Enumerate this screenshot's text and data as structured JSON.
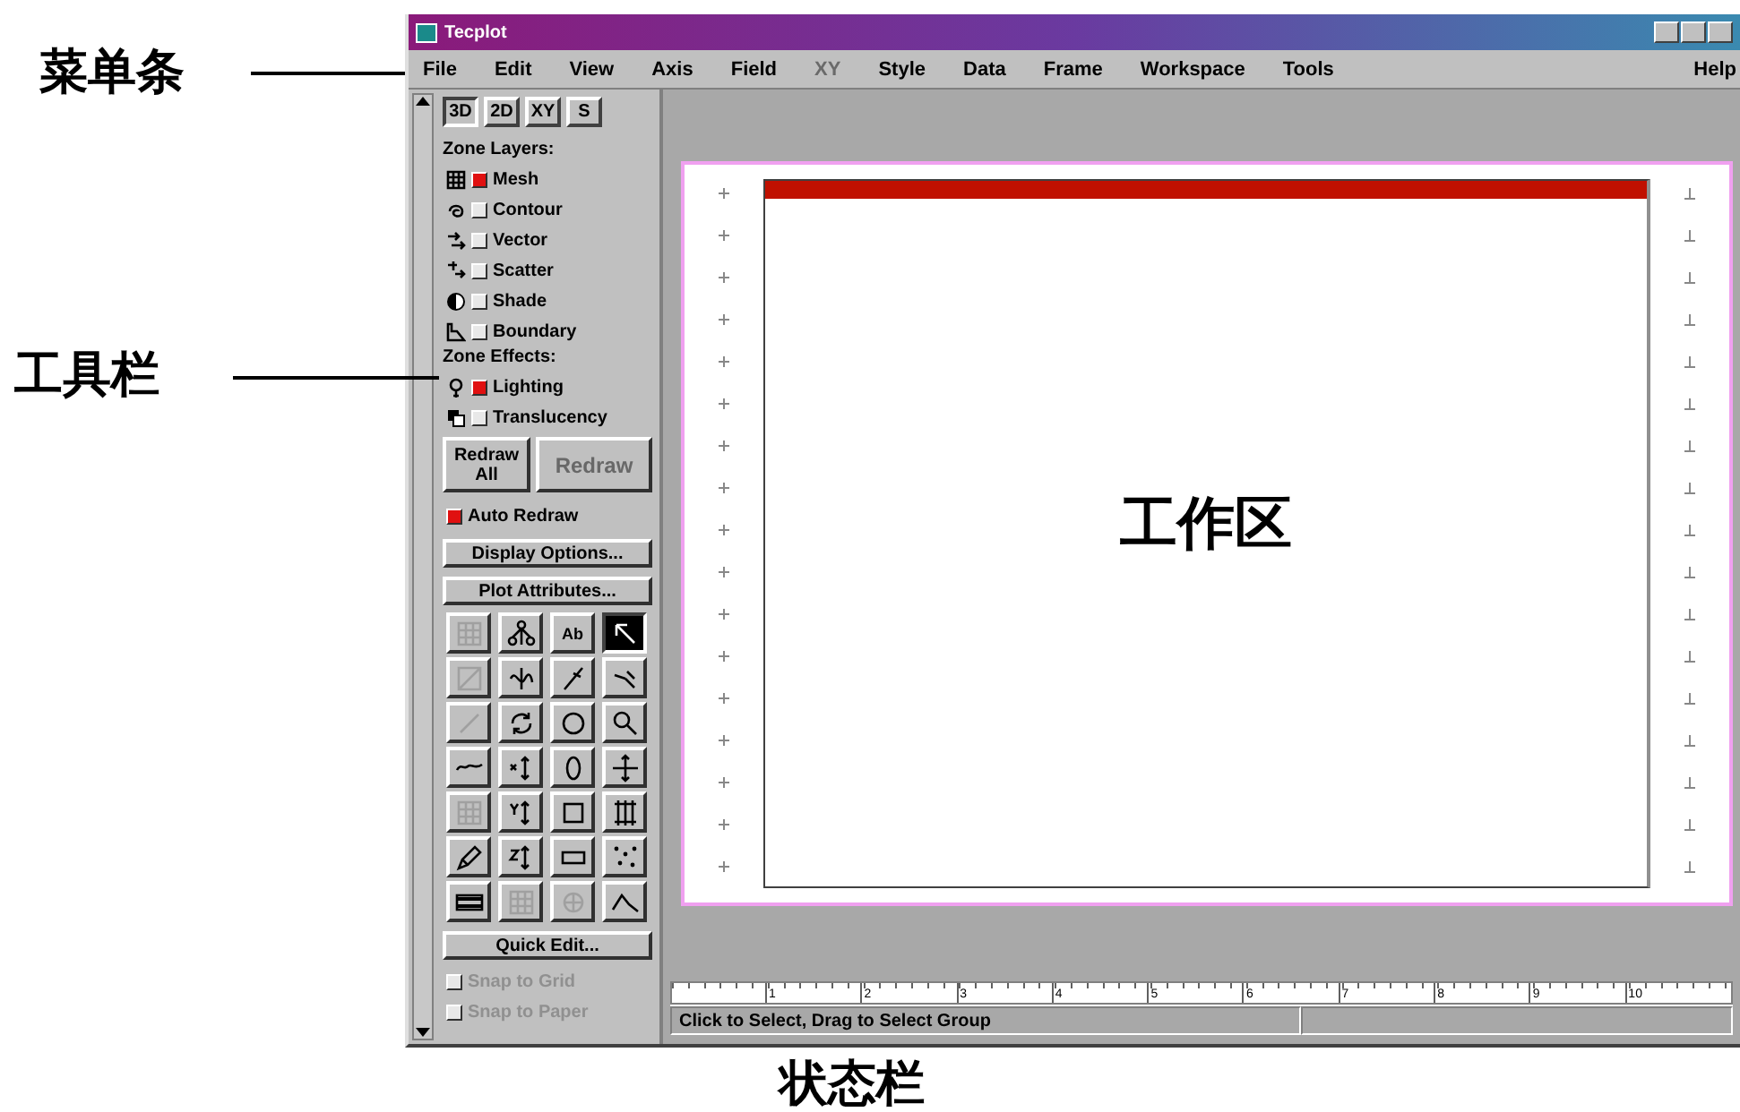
{
  "window": {
    "title": "Tecplot"
  },
  "menu": [
    {
      "label": "File",
      "disabled": false
    },
    {
      "label": "Edit",
      "disabled": false
    },
    {
      "label": "View",
      "disabled": false
    },
    {
      "label": "Axis",
      "disabled": false
    },
    {
      "label": "Field",
      "disabled": false
    },
    {
      "label": "XY",
      "disabled": true
    },
    {
      "label": "Style",
      "disabled": false
    },
    {
      "label": "Data",
      "disabled": false
    },
    {
      "label": "Frame",
      "disabled": false
    },
    {
      "label": "Workspace",
      "disabled": false
    },
    {
      "label": "Tools",
      "disabled": false
    }
  ],
  "help_menu": "Help",
  "sidebar": {
    "view_tabs": [
      {
        "label": "3D",
        "selected": true
      },
      {
        "label": "2D",
        "selected": false
      },
      {
        "label": "XY",
        "selected": false
      },
      {
        "label": "S",
        "selected": false
      }
    ],
    "zone_layers_heading": "Zone Layers:",
    "zone_layers": [
      {
        "label": "Mesh",
        "checked": true
      },
      {
        "label": "Contour",
        "checked": false
      },
      {
        "label": "Vector",
        "checked": false
      },
      {
        "label": "Scatter",
        "checked": false
      },
      {
        "label": "Shade",
        "checked": false
      },
      {
        "label": "Boundary",
        "checked": false
      }
    ],
    "zone_effects_heading": "Zone Effects:",
    "zone_effects": [
      {
        "label": "Lighting",
        "checked": true
      },
      {
        "label": "Translucency",
        "checked": false
      }
    ],
    "redraw_buttons": [
      {
        "label": "Redraw All",
        "disabled": false
      },
      {
        "label": "Redraw",
        "disabled": true
      }
    ],
    "auto_redraw": {
      "label": "Auto Redraw",
      "checked": true
    },
    "option_buttons": [
      "Display Options...",
      "Plot Attributes..."
    ],
    "tools": [
      {
        "disabled": true,
        "selected": false
      },
      {
        "disabled": false,
        "selected": false
      },
      {
        "label": "Ab",
        "disabled": false,
        "selected": false
      },
      {
        "disabled": false,
        "selected": true
      },
      {
        "disabled": true,
        "selected": false
      },
      {
        "disabled": false,
        "selected": false
      },
      {
        "disabled": false,
        "selected": false
      },
      {
        "disabled": false,
        "selected": false
      },
      {
        "disabled": true,
        "selected": false
      },
      {
        "disabled": false,
        "selected": false
      },
      {
        "disabled": false,
        "selected": false
      },
      {
        "disabled": false,
        "selected": false
      },
      {
        "disabled": false,
        "selected": false
      },
      {
        "disabled": false,
        "selected": false
      },
      {
        "disabled": false,
        "selected": false
      },
      {
        "disabled": false,
        "selected": false
      },
      {
        "disabled": true,
        "selected": false
      },
      {
        "disabled": false,
        "selected": false
      },
      {
        "disabled": false,
        "selected": false
      },
      {
        "disabled": false,
        "selected": false
      },
      {
        "disabled": false,
        "selected": false
      },
      {
        "disabled": false,
        "selected": false
      },
      {
        "disabled": false,
        "selected": false
      },
      {
        "disabled": false,
        "selected": false
      },
      {
        "disabled": false,
        "selected": false
      },
      {
        "disabled": true,
        "selected": false
      },
      {
        "disabled": true,
        "selected": false
      },
      {
        "disabled": false,
        "selected": false
      }
    ],
    "quick_edit": "Quick Edit...",
    "snap_options": [
      {
        "label": "Snap to Grid",
        "checked": false,
        "disabled": true
      },
      {
        "label": "Snap to Paper",
        "checked": false,
        "disabled": true
      }
    ]
  },
  "workspace": {
    "label": "工作区"
  },
  "ruler": {
    "labels": [
      "1",
      "2",
      "3",
      "4",
      "5",
      "6",
      "7",
      "8",
      "9",
      "10"
    ]
  },
  "status_bar": [
    "Click to Select, Drag to Select Group"
  ],
  "annotations": [
    {
      "kind": "menu",
      "label": "菜单条"
    },
    {
      "kind": "toolbar",
      "label": "工具栏"
    },
    {
      "kind": "status",
      "label": "状态栏"
    }
  ]
}
